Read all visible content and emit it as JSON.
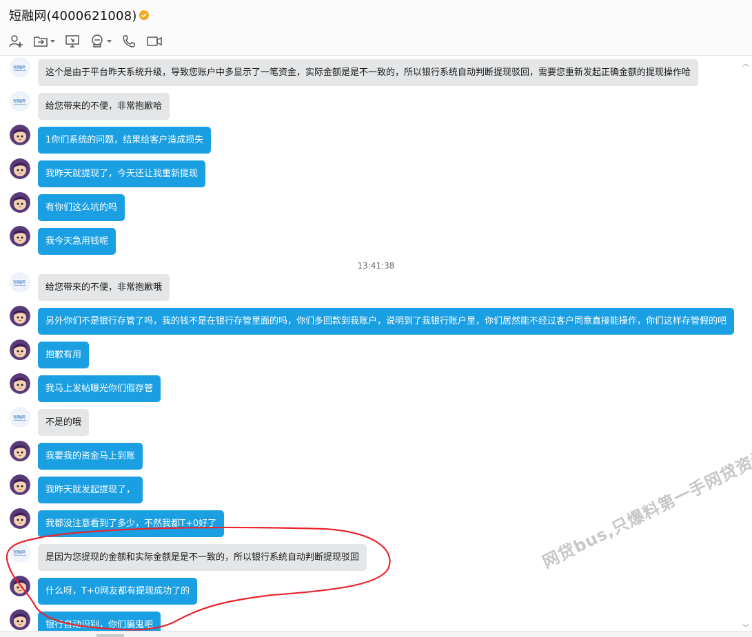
{
  "header": {
    "title": "短融网(4000621008)",
    "toolbar": [
      {
        "icon": "add-user-icon",
        "dropdown": false
      },
      {
        "icon": "transfer-file-icon",
        "dropdown": true
      },
      {
        "icon": "remote-desktop-icon",
        "dropdown": false
      },
      {
        "icon": "app-center-icon",
        "dropdown": true
      },
      {
        "icon": "phone-icon",
        "dropdown": false
      },
      {
        "icon": "video-call-icon",
        "dropdown": false
      }
    ]
  },
  "colors": {
    "user_bubble": "#1a9fe3",
    "service_bubble": "#e4e6e8",
    "annotation_circle": "#e8232b",
    "verified_badge": "#f5a623"
  },
  "timestamp": "13:41:38",
  "messages": [
    {
      "sender": "service",
      "text": "这个是由于平台昨天系统升级，导致您账户中多显示了一笔资金，实际金额是是不一致的，所以银行系统自动判断提现驳回，需要您重新发起正确金额的提现操作哈"
    },
    {
      "sender": "service",
      "text": "给您带来的不便，非常抱歉哈"
    },
    {
      "sender": "user",
      "text": "1你们系统的问题，结果给客户造成损失"
    },
    {
      "sender": "user",
      "text": "我昨天就提现了，今天还让我重新提现"
    },
    {
      "sender": "user",
      "text": "有你们这么坑的吗"
    },
    {
      "sender": "user",
      "text": "我今天急用钱呢"
    },
    {
      "sender": "service",
      "text": "给您带来的不便，非常抱歉哦"
    },
    {
      "sender": "user",
      "text": "另外你们不是银行存管了吗，我的钱不是在银行存管里面的吗，你们多回款到我账户，说明到了我银行账户里，你们居然能不经过客户同意直接能操作，你们这样存管假的吧"
    },
    {
      "sender": "user",
      "text": "抱歉有用"
    },
    {
      "sender": "user",
      "text": "我马上发帖曝光你们假存管"
    },
    {
      "sender": "service",
      "text": "不是的哦"
    },
    {
      "sender": "user",
      "text": "我要我的资金马上到账"
    },
    {
      "sender": "user",
      "text": "我昨天就发起提现了，"
    },
    {
      "sender": "user",
      "text": "我都没注意看到了多少，不然我都T+0好了"
    },
    {
      "sender": "service",
      "text": "是因为您提现的金额和实际金额是是不一致的，所以银行系统自动判断提现驳回"
    },
    {
      "sender": "user",
      "text": "什么呀，T+0网友都有提现成功了的"
    },
    {
      "sender": "user",
      "text": "银行自动识别，你们骗鬼吧"
    }
  ],
  "watermark": "网贷bus,只爆料第一手网贷资讯 www.wangdaibus.com"
}
